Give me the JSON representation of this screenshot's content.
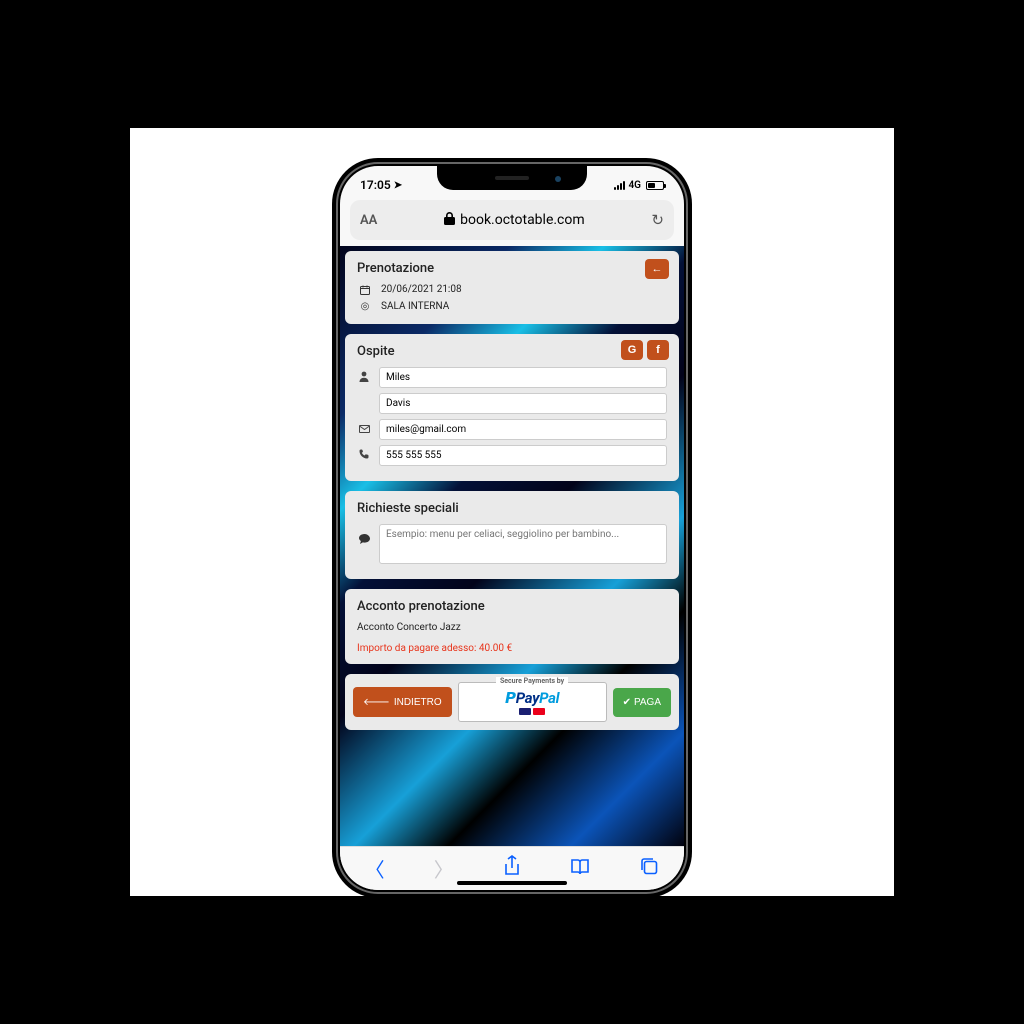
{
  "status": {
    "time": "17:05",
    "network": "4G"
  },
  "browser": {
    "url": "book.octotable.com",
    "aa": "AA"
  },
  "reservation": {
    "title": "Prenotazione",
    "datetime": "20/06/2021 21:08",
    "room": "SALA INTERNA"
  },
  "guest": {
    "title": "Ospite",
    "social_g": "G",
    "social_f": "f",
    "first_name": "Miles",
    "last_name": "Davis",
    "email": "miles@gmail.com",
    "phone": "555 555 555"
  },
  "special": {
    "title": "Richieste speciali",
    "placeholder": "Esempio: menu per celiaci, seggiolino per bambino..."
  },
  "deposit": {
    "title": "Acconto prenotazione",
    "line": "Acconto Concerto Jazz",
    "amount_label": "Importo da pagare adesso: 40.00 €"
  },
  "footer": {
    "back": "INDIETRO",
    "pay": "PAGA",
    "secure": "Secure Payments by",
    "brand_a": "Pay",
    "brand_b": "Pal"
  }
}
